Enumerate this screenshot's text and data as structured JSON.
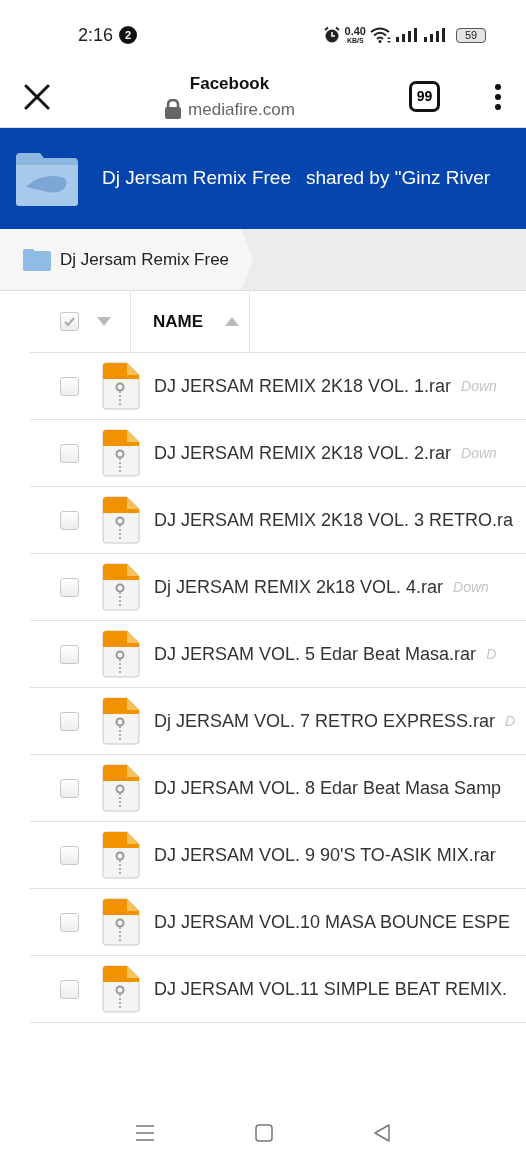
{
  "status_bar": {
    "time": "2:16",
    "notification_count": "2",
    "speed_value": "0.40",
    "speed_unit": "KB/S",
    "battery": "59"
  },
  "browser_bar": {
    "title": "Facebook",
    "url": "mediafire.com",
    "tab_count": "99"
  },
  "folder_header": {
    "title": "Dj Jersam Remix Free",
    "shared_by": "shared by \"Ginz River"
  },
  "breadcrumb": {
    "label": "Dj Jersam Remix Free"
  },
  "table": {
    "select_all_checked": true,
    "name_column": "NAME",
    "rows": [
      {
        "name": "DJ JERSAM REMIX 2K18 VOL. 1.rar",
        "hint": "Down",
        "checked": false
      },
      {
        "name": "DJ JERSAM REMIX 2K18 VOL. 2.rar",
        "hint": "Down",
        "checked": false
      },
      {
        "name": "DJ JERSAM REMIX 2K18 VOL. 3 RETRO.ra",
        "checked": false
      },
      {
        "name": "Dj JERSAM REMIX 2k18 VOL. 4.rar",
        "hint": "Down",
        "checked": false
      },
      {
        "name": "DJ JERSAM VOL. 5 Edar Beat Masa.rar",
        "hint": "D",
        "checked": false
      },
      {
        "name": "Dj JERSAM VOL. 7 RETRO EXPRESS.rar",
        "hint": "D",
        "checked": false
      },
      {
        "name": "DJ JERSAM VOL. 8 Edar Beat Masa Samp",
        "checked": false
      },
      {
        "name": "DJ JERSAM VOL. 9 90'S TO-ASIK MIX.rar",
        "checked": false
      },
      {
        "name": "DJ JERSAM VOL.10 MASA BOUNCE ESPE",
        "checked": false
      },
      {
        "name": "DJ JERSAM VOL.11 SIMPLE BEAT REMIX.",
        "checked": false
      }
    ]
  }
}
